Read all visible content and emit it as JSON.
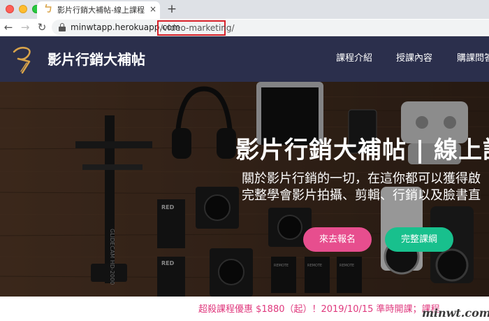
{
  "browser": {
    "tab_title": "影片行銷大補帖-線上課程 | 國際",
    "tab_close": "×",
    "new_tab": "+",
    "back": "←",
    "forward": "→",
    "reload": "↻",
    "url_host": "minwtapp.herokuapp.com",
    "url_path": "/video-marketing/",
    "favicon_glyph": "ㄅ"
  },
  "site": {
    "name": "影片行銷大補帖",
    "nav": [
      "課程介紹",
      "授課內容",
      "購課問答"
    ],
    "colors": {
      "header_bg": "#2b2f4c",
      "logo_gold": "#d9a44a"
    }
  },
  "hero": {
    "title": "影片行銷大補帖 | 線上課",
    "subtitle_line1": "關於影片行銷的一切，在這你都可以獲得啟",
    "subtitle_line2": "完整學會影片拍攝、剪輯、行銷以及臉書直",
    "btn_signup": "來去報名",
    "btn_syllabus": "完整課綱",
    "equipment_labels": [
      "GLIDECAM HD-2000",
      "RED",
      "RED",
      "REMOTE",
      "REMOTE",
      "REMOTE"
    ],
    "colors": {
      "signup": "#e74e8e",
      "syllabus": "#18c08d"
    }
  },
  "promo": {
    "text": "超殺課程優惠 $1880（起）！2019/10/15 準時開課；課程",
    "watermark": "minwt.com"
  }
}
